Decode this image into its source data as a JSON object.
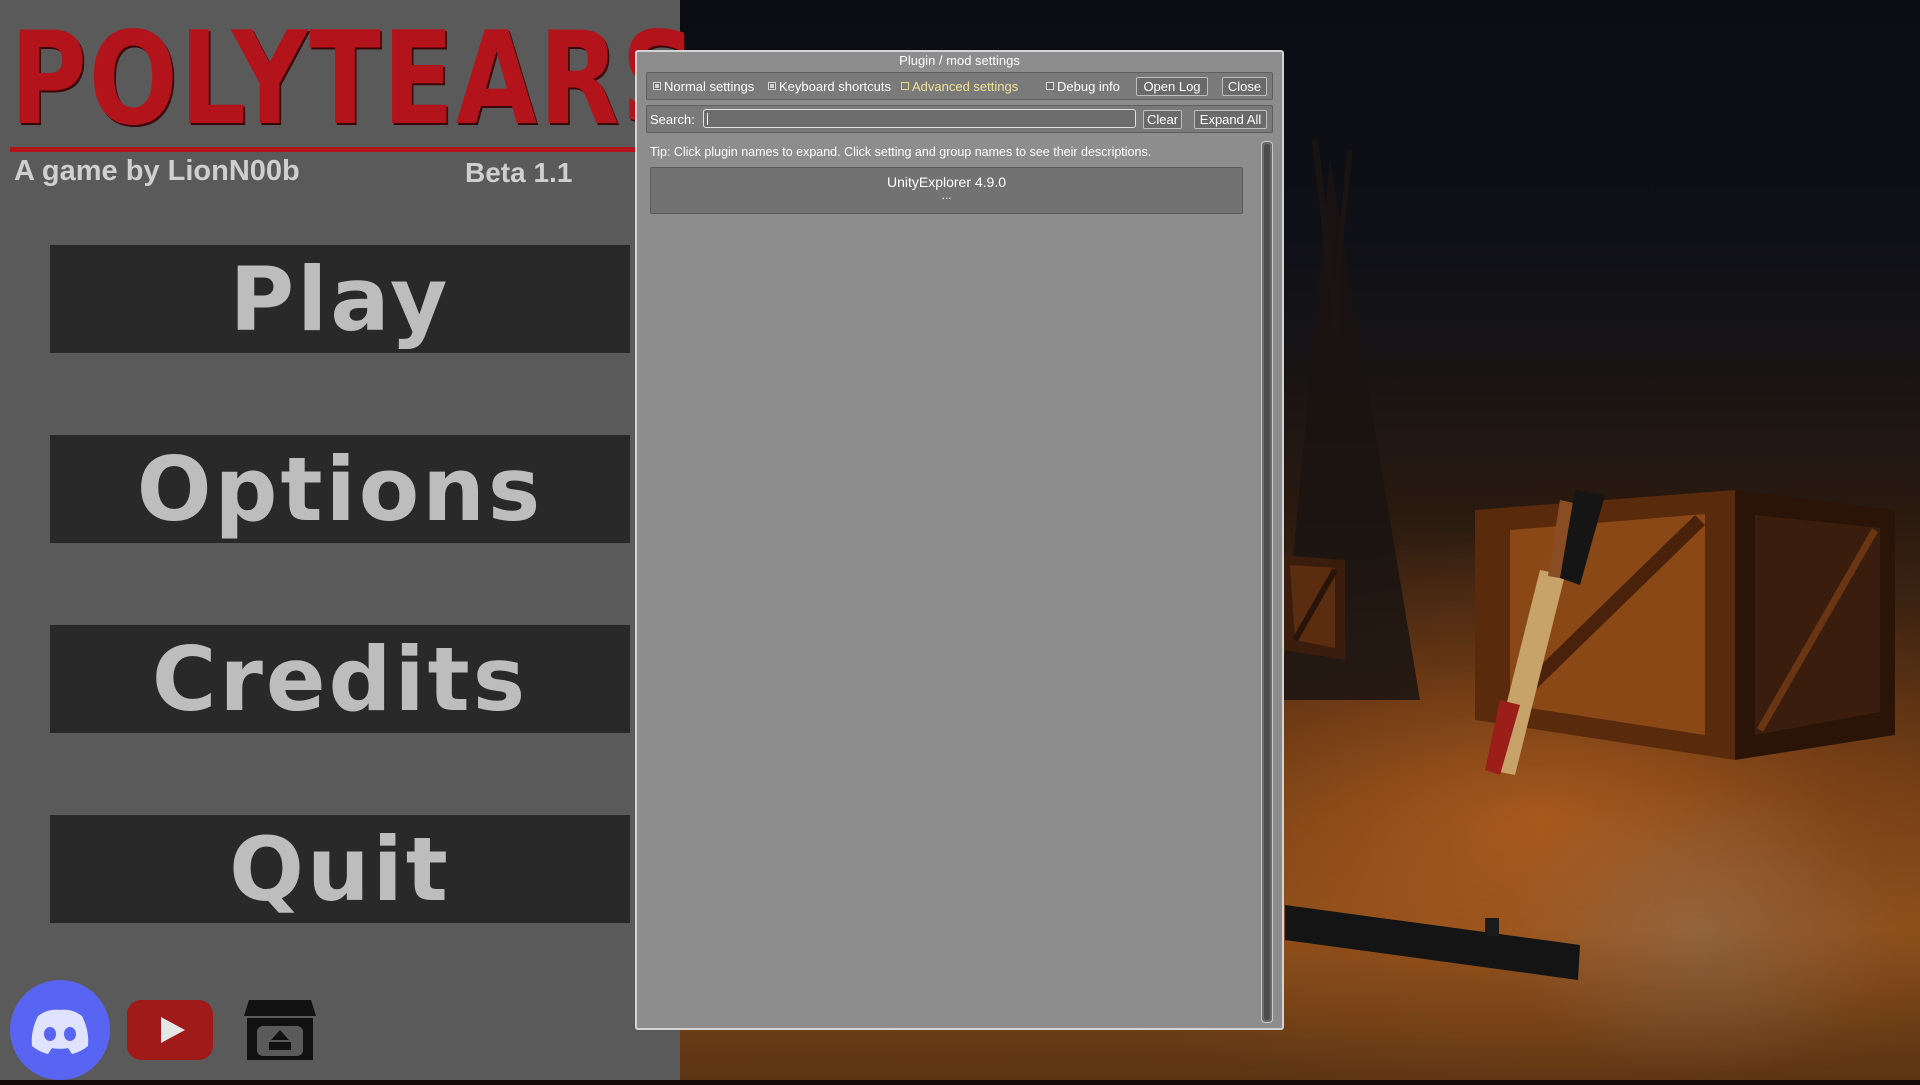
{
  "game": {
    "logo_text": "POLYTEARS",
    "subtitle": "A game by LionN00b",
    "version": "Beta 1.1",
    "menu": {
      "play": "Play",
      "options": "Options",
      "credits": "Credits",
      "quit": "Quit"
    },
    "social": [
      "discord-icon",
      "youtube-icon",
      "itchio-icon"
    ],
    "colors": {
      "logo_red": "#b3141c",
      "panel": "#5a5a5a",
      "button_bg": "#292929",
      "button_text": "#bdbdbd"
    }
  },
  "dialog": {
    "title": "Plugin / mod settings",
    "toolbar": {
      "normal_settings": {
        "label": "Normal settings",
        "checked": true
      },
      "keyboard_shortcuts": {
        "label": "Keyboard shortcuts",
        "checked": true
      },
      "advanced_settings": {
        "label": "Advanced settings",
        "checked": false
      },
      "debug_info": {
        "label": "Debug info",
        "checked": false
      },
      "open_log": "Open Log",
      "close": "Close"
    },
    "search": {
      "label": "Search:",
      "value": "",
      "clear": "Clear",
      "expand_all": "Expand All"
    },
    "tip": "Tip: Click plugin names to expand. Click setting and group names to see their descriptions.",
    "plugins": [
      {
        "name": "UnityExplorer 4.9.0",
        "more": "..."
      }
    ],
    "colors": {
      "window_bg": "#8d8d8d",
      "advanced_label": "#f0e29a"
    }
  }
}
